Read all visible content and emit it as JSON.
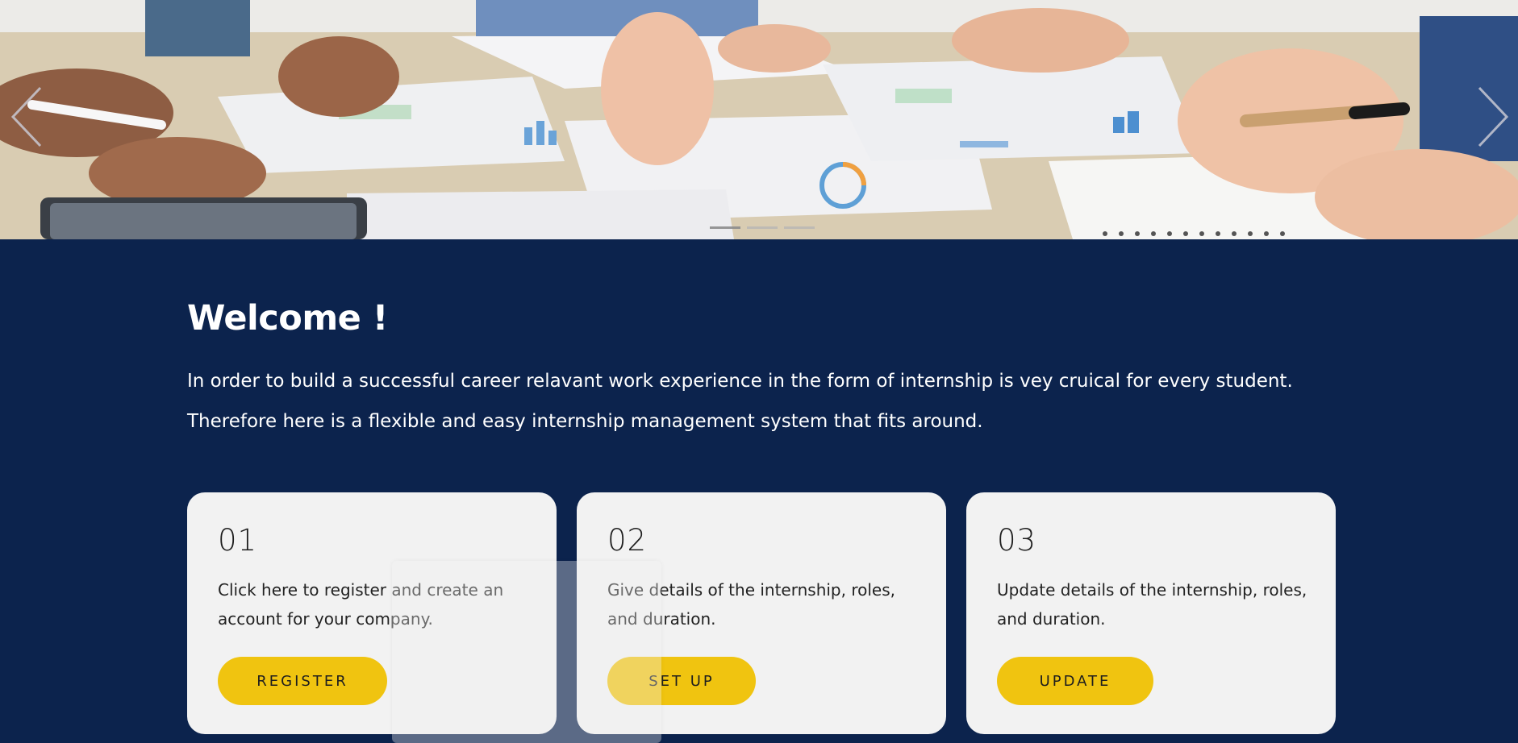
{
  "hero": {
    "indicators": [
      {
        "active": true
      },
      {
        "active": false
      },
      {
        "active": false
      }
    ],
    "prev_icon": "chevron-left-icon",
    "next_icon": "chevron-right-icon"
  },
  "welcome": {
    "title": "Welcome !",
    "line1": "In order to build a successful career relavant work experience in the form of internship is vey cruical for every student.",
    "line2": "Therefore here is a flexible and easy internship management system that fits around."
  },
  "cards": [
    {
      "number": "01",
      "description": "Click here to register and create an account for your company.",
      "button": "REGISTER"
    },
    {
      "number": "02",
      "description": "Give details of the internship, roles, and duration.",
      "button": "SET UP"
    },
    {
      "number": "03",
      "description": "Update details of the internship, roles, and duration.",
      "button": "UPDATE"
    }
  ],
  "colors": {
    "background": "#0c234d",
    "card": "#f2f2f2",
    "button": "#f0c410"
  }
}
